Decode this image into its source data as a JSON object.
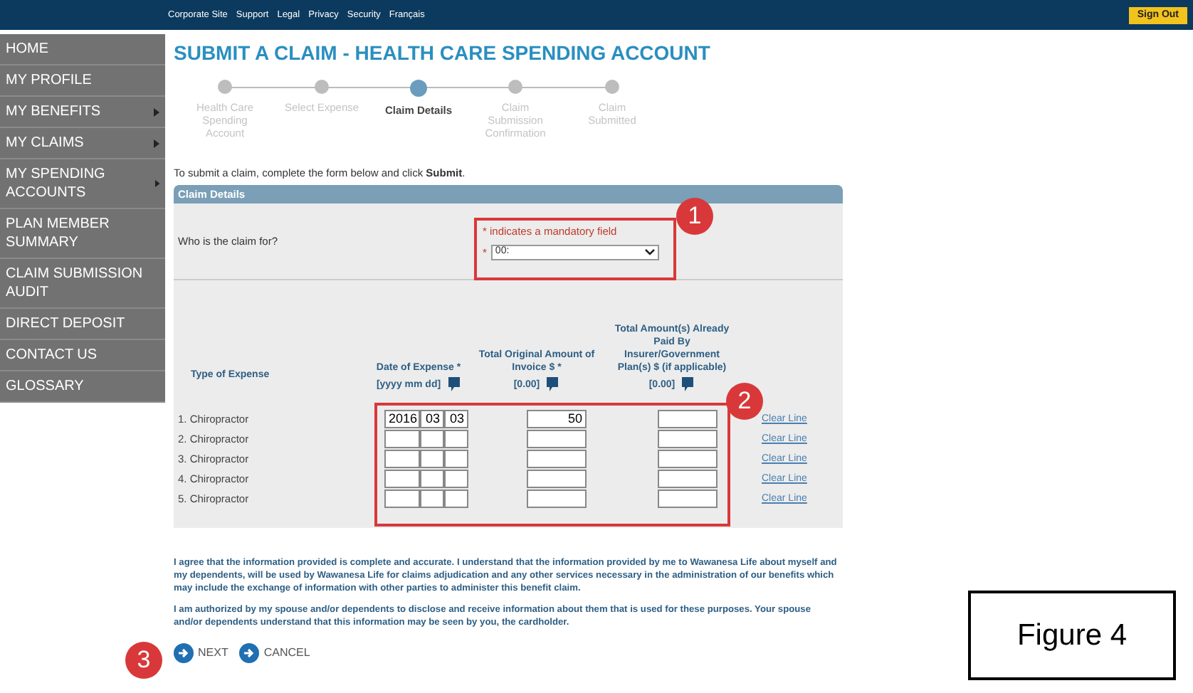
{
  "top_bar": {
    "links": [
      "Corporate Site",
      "Support",
      "Legal",
      "Privacy",
      "Security",
      "Français"
    ],
    "sign_out": "Sign Out"
  },
  "sidebar": {
    "items": [
      {
        "label": "HOME",
        "has_submenu": false
      },
      {
        "label": "MY PROFILE",
        "has_submenu": false
      },
      {
        "label": "MY BENEFITS",
        "has_submenu": true
      },
      {
        "label": "MY CLAIMS",
        "has_submenu": true
      },
      {
        "label": "MY SPENDING ACCOUNTS",
        "has_submenu": true
      },
      {
        "label": "PLAN MEMBER SUMMARY",
        "has_submenu": false
      },
      {
        "label": "CLAIM SUBMISSION AUDIT",
        "has_submenu": false
      },
      {
        "label": "DIRECT DEPOSIT",
        "has_submenu": false
      },
      {
        "label": "CONTACT US",
        "has_submenu": false
      },
      {
        "label": "GLOSSARY",
        "has_submenu": false
      }
    ]
  },
  "page_title": "SUBMIT A CLAIM - HEALTH CARE SPENDING ACCOUNT",
  "steps": [
    {
      "label": "Health Care Spending Account",
      "selected": false
    },
    {
      "label": "Select Expense",
      "selected": false
    },
    {
      "label": "Claim Details",
      "selected": true
    },
    {
      "label": "Claim Submission Confirmation",
      "selected": false
    },
    {
      "label": "Claim Submitted",
      "selected": false
    }
  ],
  "intro": "To submit a claim, complete the form below and click **Submit**.",
  "panel": {
    "title": "Claim Details",
    "mandatory_note": "* indicates a mandatory field",
    "who_label": "Who is the claim for?",
    "required_mark": "*",
    "who_value": "00:",
    "columns": [
      {
        "label": "Type of Expense"
      },
      {
        "label": "Date of Expense *",
        "hint": "[yyyy mm dd]"
      },
      {
        "label": "Total Original Amount of Invoice $ *",
        "hint": "[0.00]"
      },
      {
        "label": "Total Amount(s) Already Paid By Insurer/Government Plan(s) $ (if applicable)",
        "hint": "[0.00]"
      }
    ],
    "rows": [
      {
        "label": "1. Chiropractor",
        "year": "2016",
        "month": "03",
        "day": "03",
        "amount": "50",
        "clear": "Clear Line"
      },
      {
        "label": "2. Chiropractor",
        "clear": "Clear Line"
      },
      {
        "label": "3. Chiropractor",
        "clear": "Clear Line"
      },
      {
        "label": "4. Chiropractor",
        "clear": "Clear Line"
      },
      {
        "label": "5. Chiropractor",
        "clear": "Clear Line"
      }
    ]
  },
  "agreement": [
    "I agree that the information provided is complete and accurate. I understand that the information provided by me to Wawanesa Life about myself and my dependents, will be used by Wawanesa Life for claims adjudication and any other services necessary in the administration of our benefits which may include the exchange of information with other parties to administer this benefit claim.",
    "I am authorized by my spouse and/or dependents to disclose and receive information about them that is used for these purposes. Your spouse and/or dependents understand that this information may be seen by you, the cardholder."
  ],
  "actions": [
    "NEXT",
    "CANCEL"
  ],
  "annotations": [
    "1",
    "2",
    "3"
  ],
  "figure_label": "Figure 4"
}
